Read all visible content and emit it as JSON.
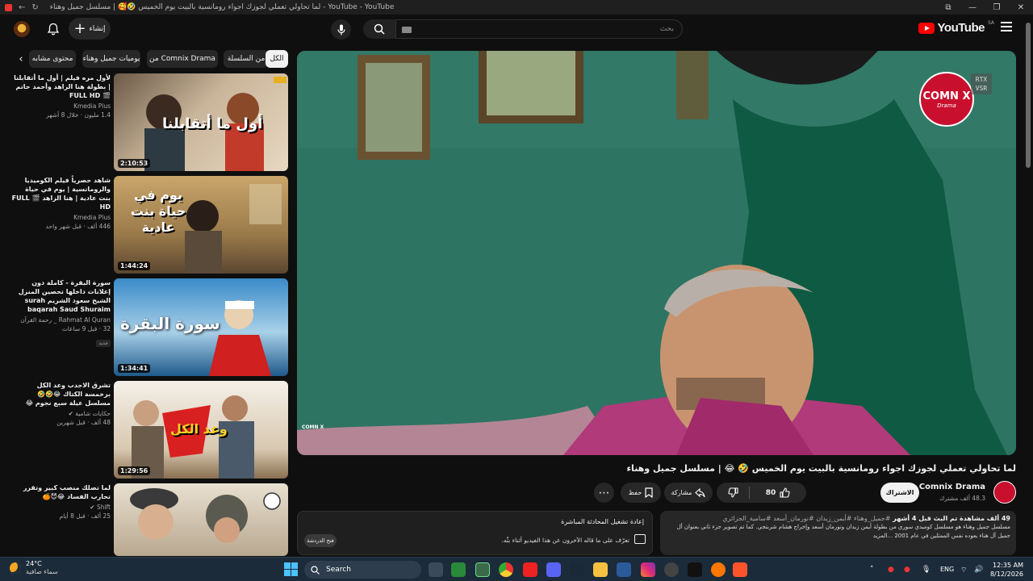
{
  "browser": {
    "title": "لما تحاولي تعملي لجوزك اجواء رومانسية بالبيت يوم الخميس 🤣🥰 | مسلسل جميل وهناء - YouTube - YouTube",
    "controls": [
      "—",
      "❐",
      "✕"
    ]
  },
  "masthead": {
    "logo_text": "YouTube",
    "logo_region": "SA",
    "search_placeholder": "بحث",
    "create_label": "إنشاء"
  },
  "chips": [
    {
      "label": "الكل",
      "active": true
    },
    {
      "label": "من السلسلة",
      "active": false
    },
    {
      "label": "من Comnix Drama",
      "active": false
    },
    {
      "label": "يوميات جميل وهناء",
      "active": false
    },
    {
      "label": "محتوى مشابه",
      "active": false
    }
  ],
  "recommendations": [
    {
      "title": "لأول مره فيلم | أول ما أتقابلنا | بطولة هنا الزاهد وأحمد حاتم 🎬 FULL HD",
      "channel": "Kmedia Plus",
      "stats": "1.4 مليون · خلال 8 أشهر",
      "duration": "2:10:53",
      "thumb_text": "أول ما أتقابلنا",
      "badge": ""
    },
    {
      "title": "شاهد حصرياً فيلم الكوميديا والرومانسية | يوم في حياة بنت عادية | هنا الزاهد 🎬 FULL HD",
      "channel": "Kmedia Plus",
      "stats": "446 ألف · قبل شهر واحد",
      "duration": "1:44:24",
      "thumb_text": "يوم في حياة بنت عادية",
      "badge": ""
    },
    {
      "title": "سورة البقرة - كاملة دون إعلانات داخلها تحصين المنزل الشيخ سعود الشريم surah baqarah Saud Shuraim",
      "channel": "Rahmat Al Quran _ رحمة القرآن",
      "stats": "32 · قبل 9 ساعات",
      "duration": "1:34:41",
      "thumb_text": "سورة البقرة",
      "badge": "جديد"
    },
    {
      "title": "تشرق الاجدب وعد الكل برخمسة الكتاك 😂🤣🤣 مسلسل عيلة سبع نجوم 😂",
      "channel": "حكايات شامية ✔",
      "stats": "48 ألف · قبل شهرين",
      "duration": "1:29:56",
      "thumb_text": "وعد الكل",
      "badge": ""
    },
    {
      "title": "لما تصلك منصب كبير وتقرر تحارب الفساد 😂😈🍊",
      "channel": "Shift ✔",
      "stats": "25 ألف · قبل 8 أيام",
      "duration": "",
      "thumb_text": "",
      "badge": ""
    }
  ],
  "player": {
    "watermark": "COMN X",
    "watermark_sub": "Drama",
    "rtx_label": "RTX VSR"
  },
  "video": {
    "title": "لما تحاولي تعملي لجوزك اجواء رومانسية بالبيت يوم الخميس 🤣 😂 | مسلسل جميل وهناء",
    "channel": "Comnix Drama",
    "subscribers": "48.3 ألف مشترك",
    "subscribe_label": "الاشتراك",
    "likes": "80",
    "share_label": "مشاركة",
    "save_label": "حفظ"
  },
  "description": {
    "stats": "49 ألف مشاهدة  تم البث قبل 4 أشهر",
    "tags": "#جميل_وهناء #أيمن_زيدان #نورمان_أسعد #سامية_الجزائري",
    "text": "مسلسل جميل وهناء هو مسلسل كوميدي سوري من بطولة أيمن زيدان ونورمان أسعد وإخراج هشام شربتجي. كما تم تصوير جزء ثاني بعنوان أل جميل أل هناء بعوده نفس الممثلين في عام 2001  ...المزيد"
  },
  "live_chat": {
    "header": "إعادة تشغيل المحادثة المباشرة",
    "message": "تعرّف على ما قاله الآخرون عن هذا الفيديو أثناء بثّه.",
    "button": "فتح الدردشة"
  },
  "taskbar": {
    "weather_temp": "24°C",
    "weather_desc": "سماء صافية",
    "search_label": "Search",
    "lang": "ENG",
    "time": "12:35 AM",
    "date": "8/12/2026"
  },
  "colors": {
    "background": "#0f0f0f",
    "brand_red": "#ff0000",
    "chip_bg": "#272727",
    "accent_blue": "#4cc2ff"
  }
}
